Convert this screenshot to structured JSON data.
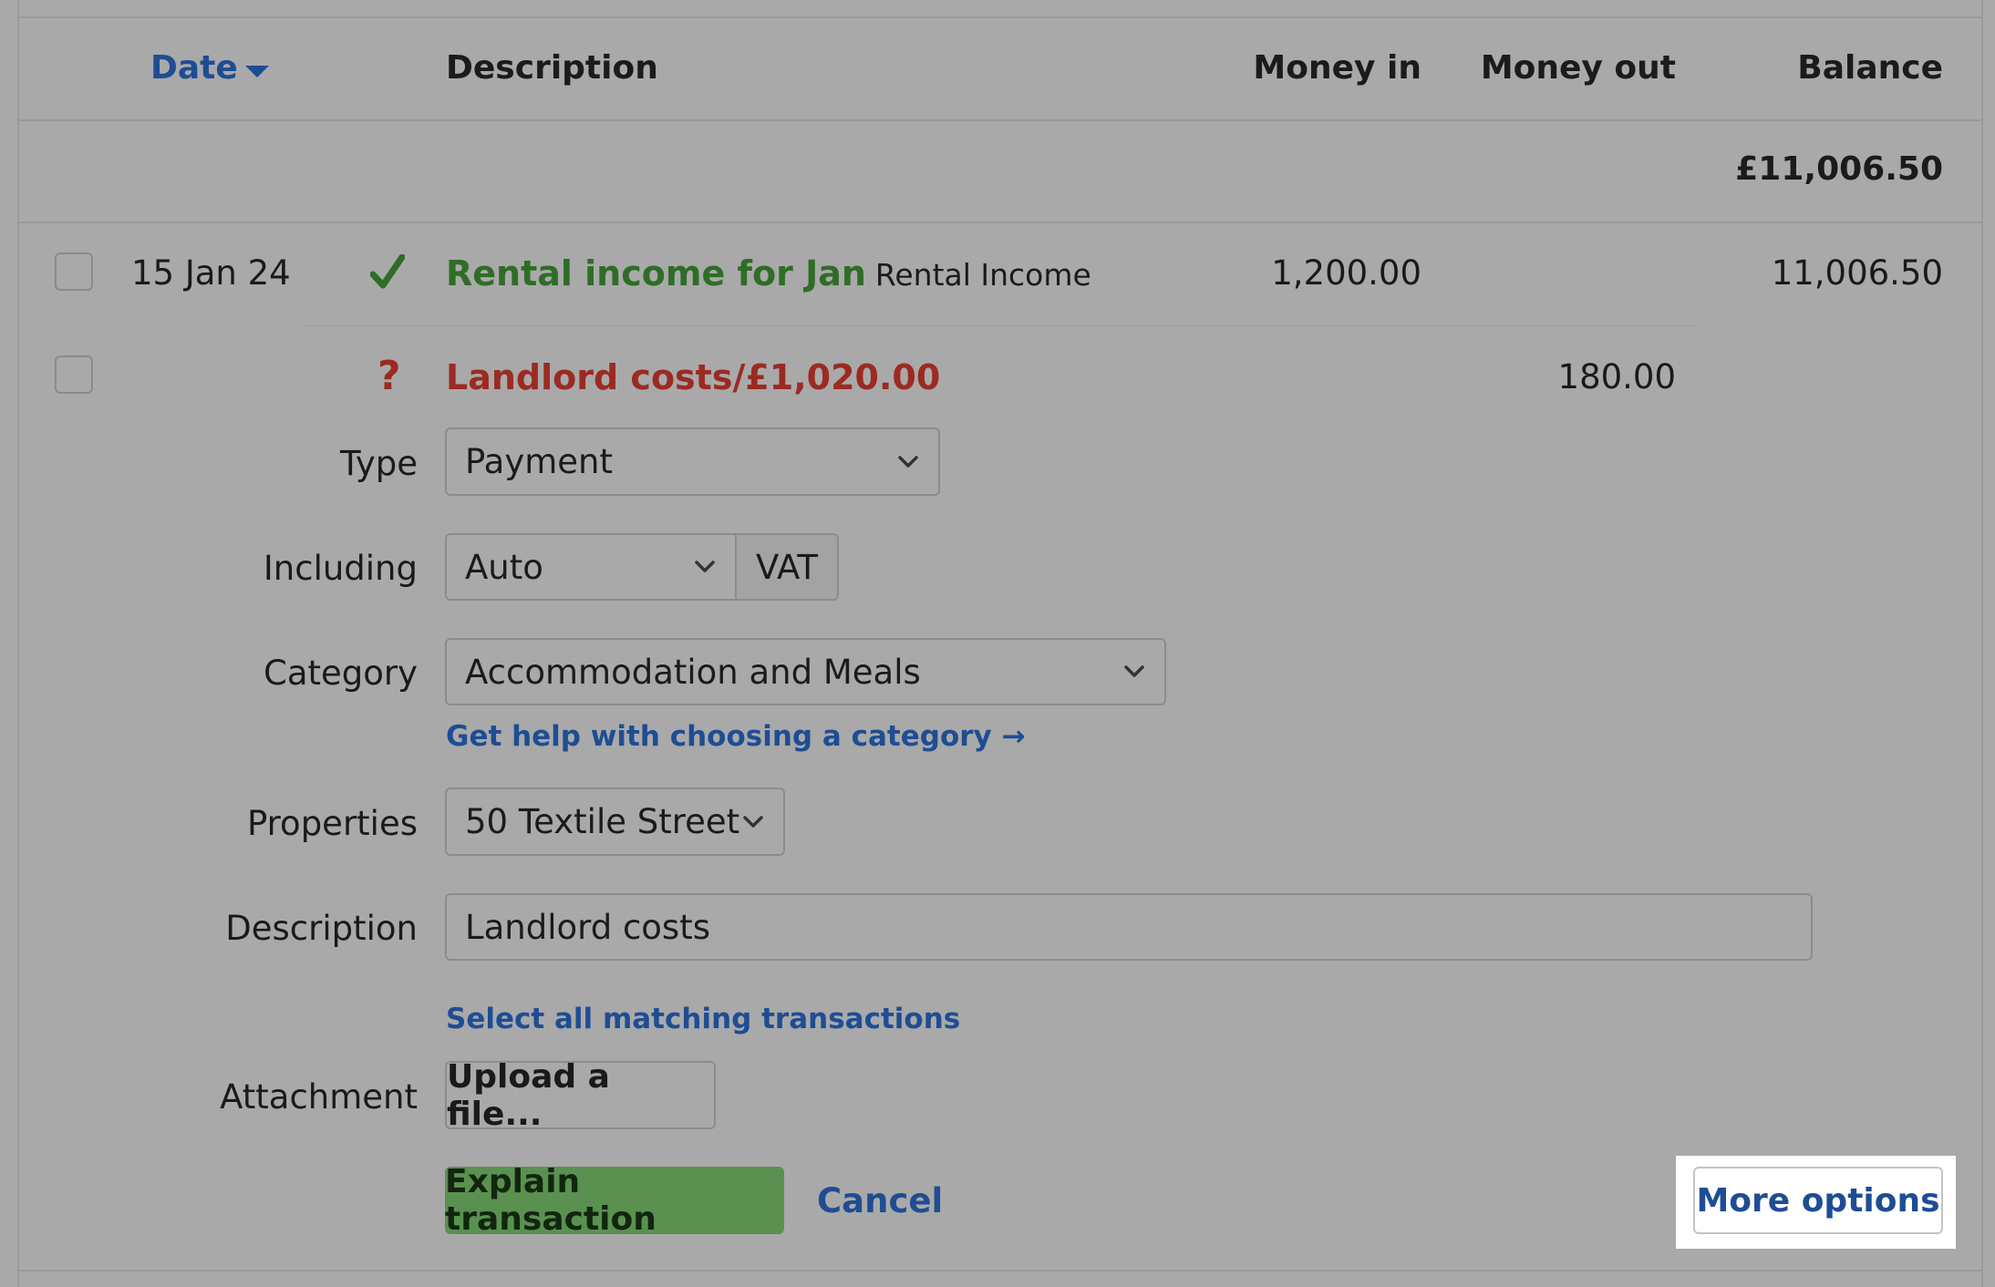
{
  "columns": {
    "date": "Date",
    "description": "Description",
    "money_in": "Money in",
    "money_out": "Money out",
    "balance": "Balance"
  },
  "opening_balance": "£11,006.50",
  "rows": [
    {
      "date": "15 Jan 24",
      "status": "check-icon",
      "description": "Rental income for Jan",
      "tag": "Rental Income",
      "money_in": "1,200.00",
      "balance": "11,006.50"
    },
    {
      "status": "question-icon",
      "description": "Landlord costs/£1,020.00",
      "money_out": "180.00"
    }
  ],
  "form": {
    "type_label": "Type",
    "type_value": "Payment",
    "including_label": "Including",
    "including_value": "Auto",
    "vat_label": "VAT",
    "category_label": "Category",
    "category_value": "Accommodation and Meals",
    "category_help_link": "Get help with choosing a category →",
    "properties_label": "Properties",
    "properties_value": "50 Textile Street",
    "description_label": "Description",
    "description_value": "Landlord costs",
    "select_matching_link": "Select all matching transactions",
    "attachment_label": "Attachment",
    "upload_button": "Upload a file...",
    "explain_button": "Explain transaction",
    "cancel_link": "Cancel",
    "more_options_button": "More options"
  },
  "colors": {
    "background": "#a9a9a9",
    "link_blue": "#1e4d94",
    "income_green": "#2f6d27",
    "unexplained_red": "#9b2a22",
    "primary_button": "#5a9150"
  }
}
